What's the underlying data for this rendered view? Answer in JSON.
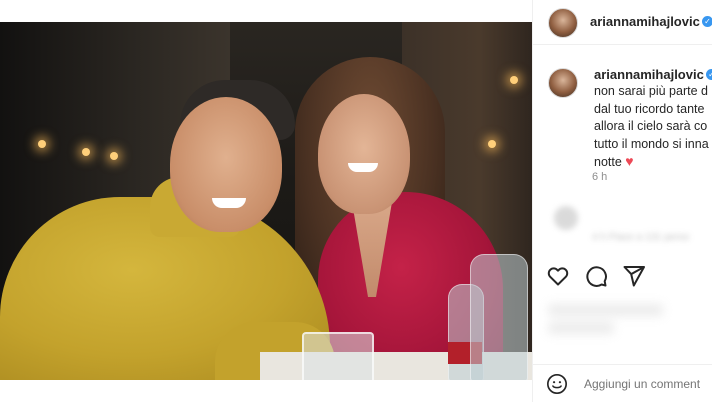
{
  "post": {
    "photo_alt": "",
    "author": {
      "username": "ariannamihajlovic",
      "verified": true
    },
    "caption": {
      "username": "ariannamihajlovic",
      "lines": [
        "non sarai più parte d",
        "dal tuo ricordo tante",
        "allora il cielo sarà co",
        "tutto il mondo si inna",
        "notte"
      ],
      "heart": "❤️",
      "timestamp": "6 h"
    },
    "blurred_comment": {
      "meta": "4 h    Piace a 131 perso"
    },
    "actions": {
      "like_icon": "heart-outline-icon",
      "comment_icon": "comment-icon",
      "share_icon": "paper-plane-icon"
    },
    "comment_box": {
      "emoji_icon": "emoji-smile-icon",
      "placeholder": "Aggiungi un comment"
    }
  },
  "colors": {
    "verified": "#3897f0",
    "text_primary": "#262626",
    "text_secondary": "#8e8e8e",
    "border": "#efefef",
    "heart": "#ed4956"
  }
}
